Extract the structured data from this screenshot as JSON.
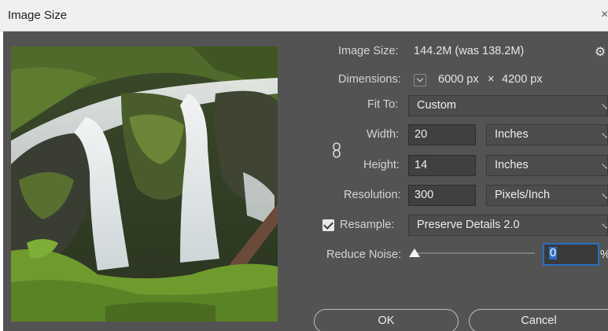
{
  "window": {
    "title": "Image Size",
    "close_glyph": "×"
  },
  "info": {
    "image_size_label": "Image Size:",
    "image_size_value": "144.2M (was 138.2M)",
    "dimensions_label": "Dimensions:",
    "dimensions_width": "6000 px",
    "dimensions_separator": "×",
    "dimensions_height": "4200 px"
  },
  "fields": {
    "fit_to_label": "Fit To:",
    "fit_to_value": "Custom",
    "width_label": "Width:",
    "width_value": "20",
    "width_unit": "Inches",
    "height_label": "Height:",
    "height_value": "14",
    "height_unit": "Inches",
    "resolution_label": "Resolution:",
    "resolution_value": "300",
    "resolution_unit": "Pixels/Inch",
    "resample_label": "Resample:",
    "resample_checked": true,
    "resample_value": "Preserve Details 2.0",
    "reduce_noise_label": "Reduce Noise:",
    "reduce_noise_value": "0",
    "reduce_noise_unit": "%"
  },
  "buttons": {
    "ok": "OK",
    "cancel": "Cancel"
  },
  "icons": {
    "settings": "gear-icon",
    "link": "chain-link-icon",
    "dimensions_toggle": "chevron-down-icon",
    "resample_checkbox": "checkmark-icon"
  },
  "colors": {
    "dialog_bg": "#535353",
    "field_bg": "#404040",
    "focus": "#2a6fc4",
    "titlebar_bg": "#f0f0f0"
  }
}
